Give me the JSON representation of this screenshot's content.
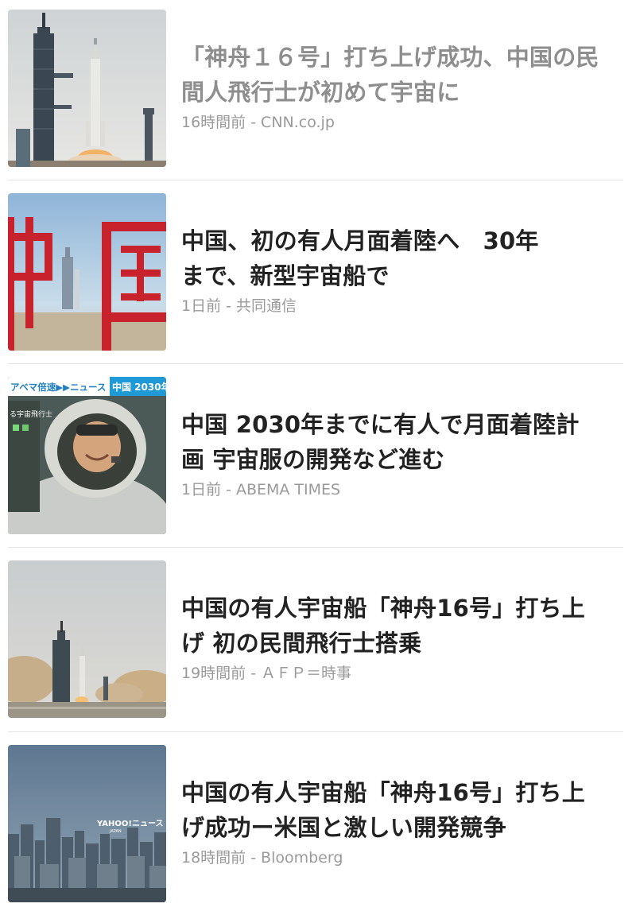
{
  "articles": [
    {
      "headline_line1": "「神舟１６号」打ち上げ成功、中国の民",
      "headline_line2": "間人飛行士が初めて宇宙に",
      "time": "16時間前",
      "separator": "-",
      "source": "CNN.co.jp",
      "read": true,
      "thumbnail": "rocket-launch-pad-photo"
    },
    {
      "headline_line1": "中国、初の有人月面着陸へ　30年",
      "headline_line2": "まで、新型宇宙船で",
      "time": "1日前",
      "separator": "-",
      "source": "共同通信",
      "read": false,
      "thumbnail": "china-sign-rocket-photo"
    },
    {
      "headline_line1": "中国 2030年までに有人で月面着陸計",
      "headline_line2": "画 宇宙服の開発など進む",
      "time": "1日前",
      "separator": "-",
      "source": "ABEMA TIMES",
      "read": false,
      "thumbnail": "astronaut-in-helmet-photo",
      "thumb_banner_left": "アベマ倍速▶▶ニュース",
      "thumb_banner_right": "中国 2030年",
      "thumb_caption": "る宇宙飛行士"
    },
    {
      "headline_line1": "中国の有人宇宙船「神舟16号」打ち上",
      "headline_line2": "げ 初の民間飛行士搭乗",
      "time": "19時間前",
      "separator": "-",
      "source": "ＡＦＰ＝時事",
      "read": false,
      "thumbnail": "rocket-liftoff-smoke-photo"
    },
    {
      "headline_line1": "中国の有人宇宙船「神舟16号」打ち上",
      "headline_line2": "げ成功ー米国と激しい開発競争",
      "time": "18時間前",
      "separator": "-",
      "source": "Bloomberg",
      "read": false,
      "thumbnail": "city-skyline-photo",
      "thumb_watermark": "YAHOO!ニュース",
      "thumb_watermark_sub": "JAPAN"
    }
  ]
}
